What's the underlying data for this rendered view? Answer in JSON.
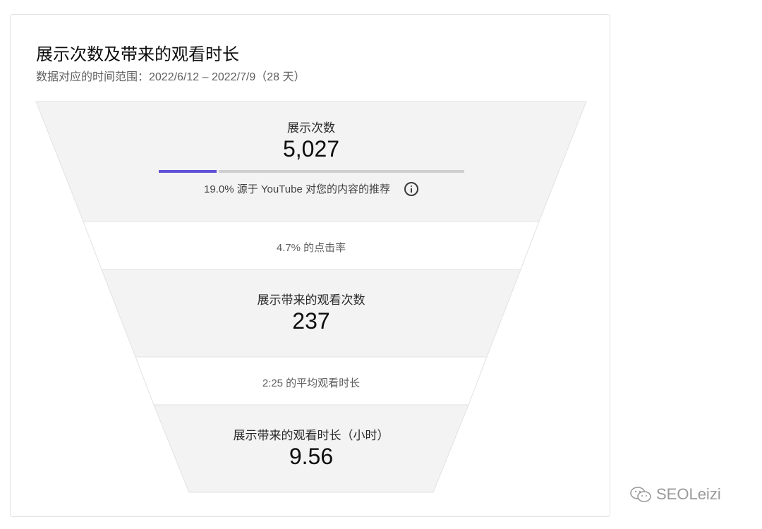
{
  "card": {
    "title": "展示次数及带来的观看时长",
    "subtitle": "数据对应的时间范围：2022/6/12 – 2022/7/9（28 天）"
  },
  "funnel": {
    "impressions": {
      "label": "展示次数",
      "value": "5,027",
      "recommendation_share": 0.19,
      "recommendation_text": "19.0% 源于 YouTube 对您的内容的推荐",
      "info_icon": "info-circle-icon"
    },
    "ctr": {
      "text": "4.7% 的点击率"
    },
    "views": {
      "label": "展示带来的观看次数",
      "value": "237"
    },
    "avg_watch": {
      "text": "2:25 的平均观看时长"
    },
    "watch_time": {
      "label": "展示带来的观看时长（小时）",
      "value": "9.56"
    }
  },
  "colors": {
    "funnel_fill": "#f3f3f3",
    "funnel_gap": "#ffffff",
    "progress_fill": "#5f52d6",
    "progress_track": "#cfcfcf"
  },
  "watermark": {
    "icon": "wechat-icon",
    "text": "SEOLeizi"
  }
}
